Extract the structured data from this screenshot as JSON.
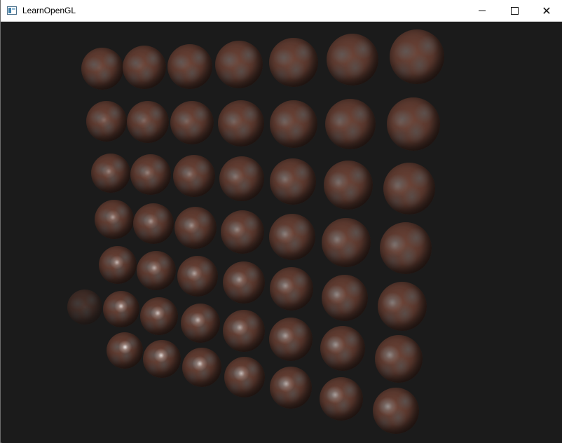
{
  "window": {
    "title": "LearnOpenGL",
    "controls": {
      "minimize": "—",
      "maximize": "☐",
      "close": "✕"
    }
  },
  "scene": {
    "background_color": "#1b1b1b",
    "object": "sphere",
    "grid_rows": 7,
    "grid_columns": 7
  }
}
